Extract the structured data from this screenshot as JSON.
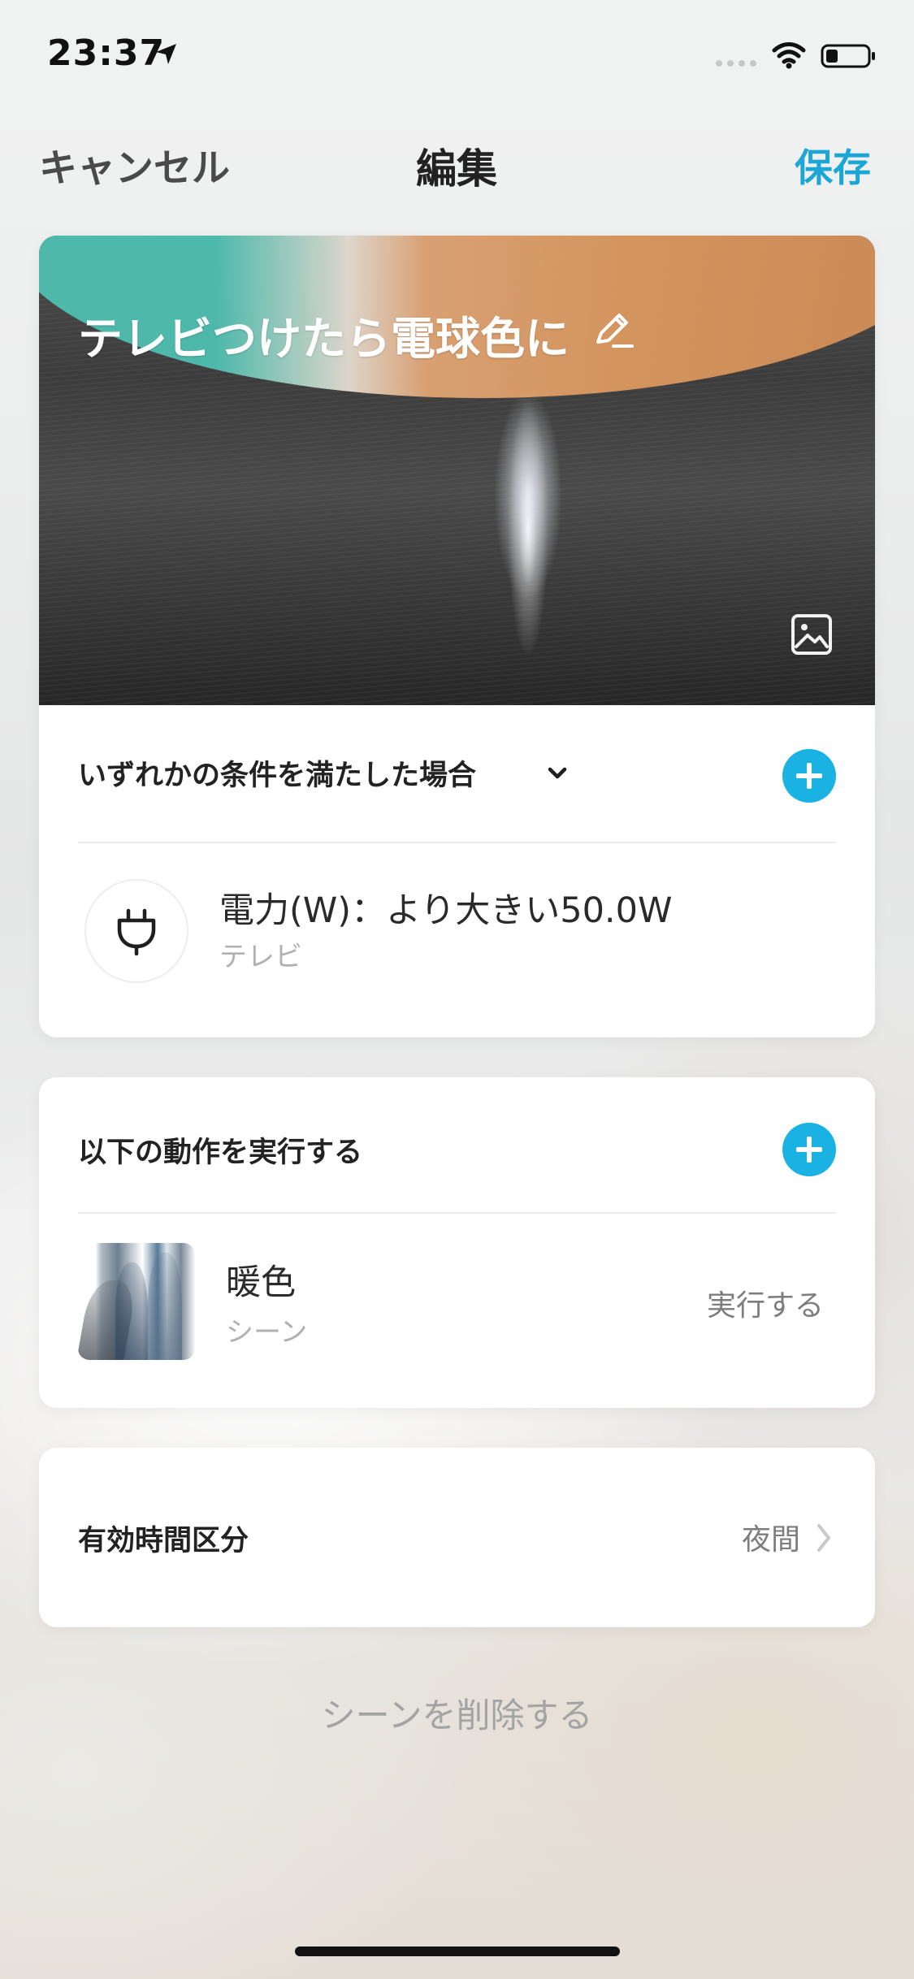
{
  "status_bar": {
    "time": "23:37"
  },
  "nav": {
    "cancel_label": "キャンセル",
    "title": "編集",
    "save_label": "保存"
  },
  "scene": {
    "title": "テレビつけたら電球色に"
  },
  "conditions": {
    "header": "いずれかの条件を満たした場合",
    "item": {
      "title": "電力(W)：より大きい50.0W",
      "subtitle": "テレビ",
      "icon": "plug-icon"
    }
  },
  "actions": {
    "header": "以下の動作を実行する",
    "item": {
      "title": "暖色",
      "subtitle": "シーン",
      "action": "実行する"
    }
  },
  "time_period": {
    "label": "有効時間区分",
    "value": "夜間"
  },
  "delete_scene_label": "シーンを削除する",
  "colors": {
    "accent": "#19b2e3",
    "nav_action": "#1ba6d6"
  },
  "icons": {
    "location": "location-arrow-icon",
    "signal": "cellular-signal-icon",
    "wifi": "wifi-icon",
    "battery": "battery-icon",
    "edit": "pencil-icon",
    "image": "image-icon",
    "dropdown": "chevron-down-icon",
    "add": "plus-icon",
    "next": "chevron-right-icon"
  }
}
